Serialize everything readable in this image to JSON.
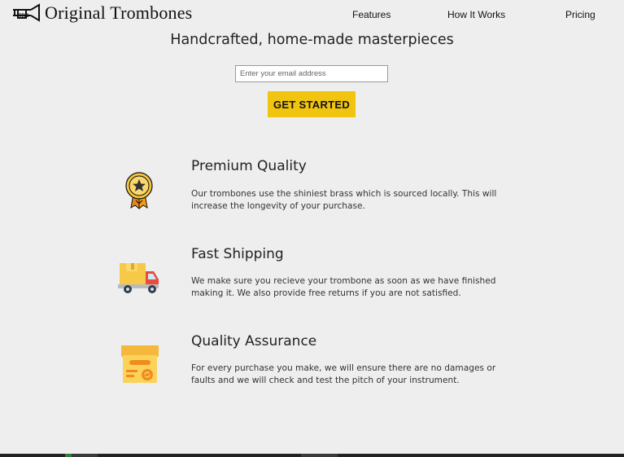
{
  "header": {
    "logo_text": "Original Trombones",
    "logo_icon": "trombone-logo-icon",
    "nav": [
      {
        "label": "Features"
      },
      {
        "label": "How It Works"
      },
      {
        "label": "Pricing"
      }
    ]
  },
  "hero": {
    "title": "Handcrafted, home-made masterpieces",
    "email_placeholder": "Enter your email address",
    "cta_label": "GET STARTED"
  },
  "features": [
    {
      "icon": "medal-icon",
      "title": "Premium Quality",
      "description": "Our trombones use the shiniest brass which is sourced locally. This will increase the longevity of your purchase."
    },
    {
      "icon": "delivery-truck-icon",
      "title": "Fast Shipping",
      "description": "We make sure you recieve your trombone as soon as we have finished making it. We also provide free returns if you are not satisfied."
    },
    {
      "icon": "product-box-icon",
      "title": "Quality Assurance",
      "description": "For every purchase you make, we will ensure there are no damages or faults and we will check and test the pitch of your instrument."
    }
  ],
  "colors": {
    "background": "#eeeeee",
    "accent": "#f1c40f",
    "text": "#222222"
  }
}
